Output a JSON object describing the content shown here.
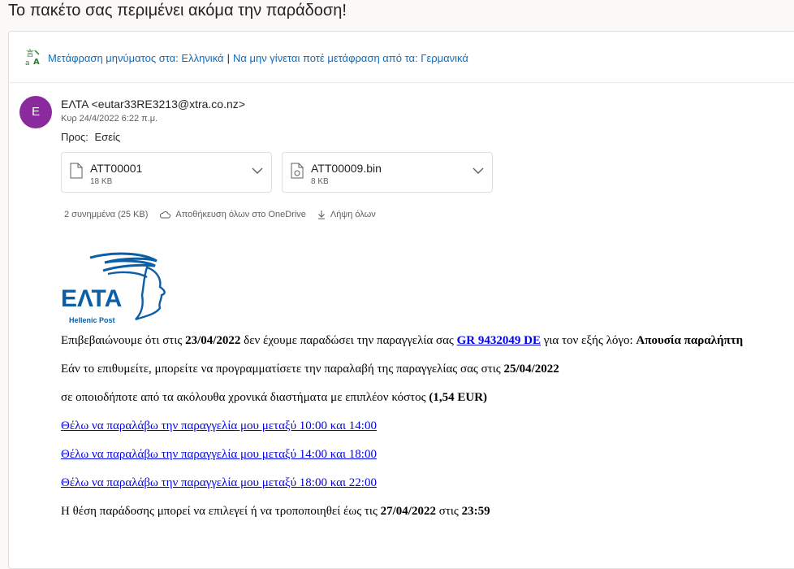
{
  "subject": "Το πακέτο σας περιμένει ακόμα την παράδοση!",
  "translate": {
    "icon": "translate-icon",
    "translate_link": "Μετάφραση μηνύματος στα: Ελληνικά",
    "separator": "|",
    "never_link": "Να μην γίνεται ποτέ μετάφραση από τα: Γερμανικά"
  },
  "message": {
    "avatar_letter": "E",
    "sender": "ΕΛΤΑ <eutar33RE3213@xtra.co.nz>",
    "date": "Κυρ 24/4/2022 6:22 π.μ.",
    "to_label": "Προς:",
    "to_value": "Εσείς"
  },
  "attachments": [
    {
      "name": "ATT00001",
      "size": "18 KB",
      "icon": "file-icon"
    },
    {
      "name": "ATT00009.bin",
      "size": "8 KB",
      "icon": "file-bin-icon"
    }
  ],
  "attachment_actions": {
    "count": "2 συνημμένα (25 KB)",
    "save_onedrive": "Αποθήκευση όλων στο OneDrive",
    "download_all": "Λήψη όλων"
  },
  "logo": {
    "text": "ΕΛΤΑ",
    "subtext": "Hellenic Post",
    "color": "#0a5fa8"
  },
  "body": {
    "p1_pre": "Επιβεβαιώνουμε ότι στις ",
    "p1_date": "23/04/2022",
    "p1_mid": " δεν έχουμε παραδώσει την παραγγελία σας ",
    "p1_order": "GR 9432049 DE",
    "p1_mid2": " για τον εξής λόγο: ",
    "p1_reason": "Απουσία παραλήπτη",
    "p2_pre": "Εάν το επιθυμείτε, μπορείτε να προγραμματίσετε την παραλαβή της παραγγελίας σας στις ",
    "p2_date": "25/04/2022",
    "p3_pre": "σε οποιοδήποτε από τα ακόλουθα χρονικά διαστήματα με επιπλέον κόστος ",
    "p3_cost": "(1,54 EUR)",
    "link1": "Θέλω να παραλάβω την παραγγελία μου μεταξύ 10:00 και 14:00",
    "link2": "Θέλω να παραλάβω την παραγγελία μου μεταξύ 14:00 και 18:00",
    "link3": "Θέλω να παραλάβω την παραγγελία μου μεταξύ 18:00 και 22:00",
    "p4_pre": "Η θέση παράδοσης μπορεί να επιλεγεί ή να τροποποιηθεί έως τις ",
    "p4_date": "27/04/2022",
    "p4_mid": " στις ",
    "p4_time": "23:59"
  },
  "colors": {
    "link": "#0f6cbd",
    "avatar": "#8b2a9c",
    "body_link": "#0000ee"
  }
}
